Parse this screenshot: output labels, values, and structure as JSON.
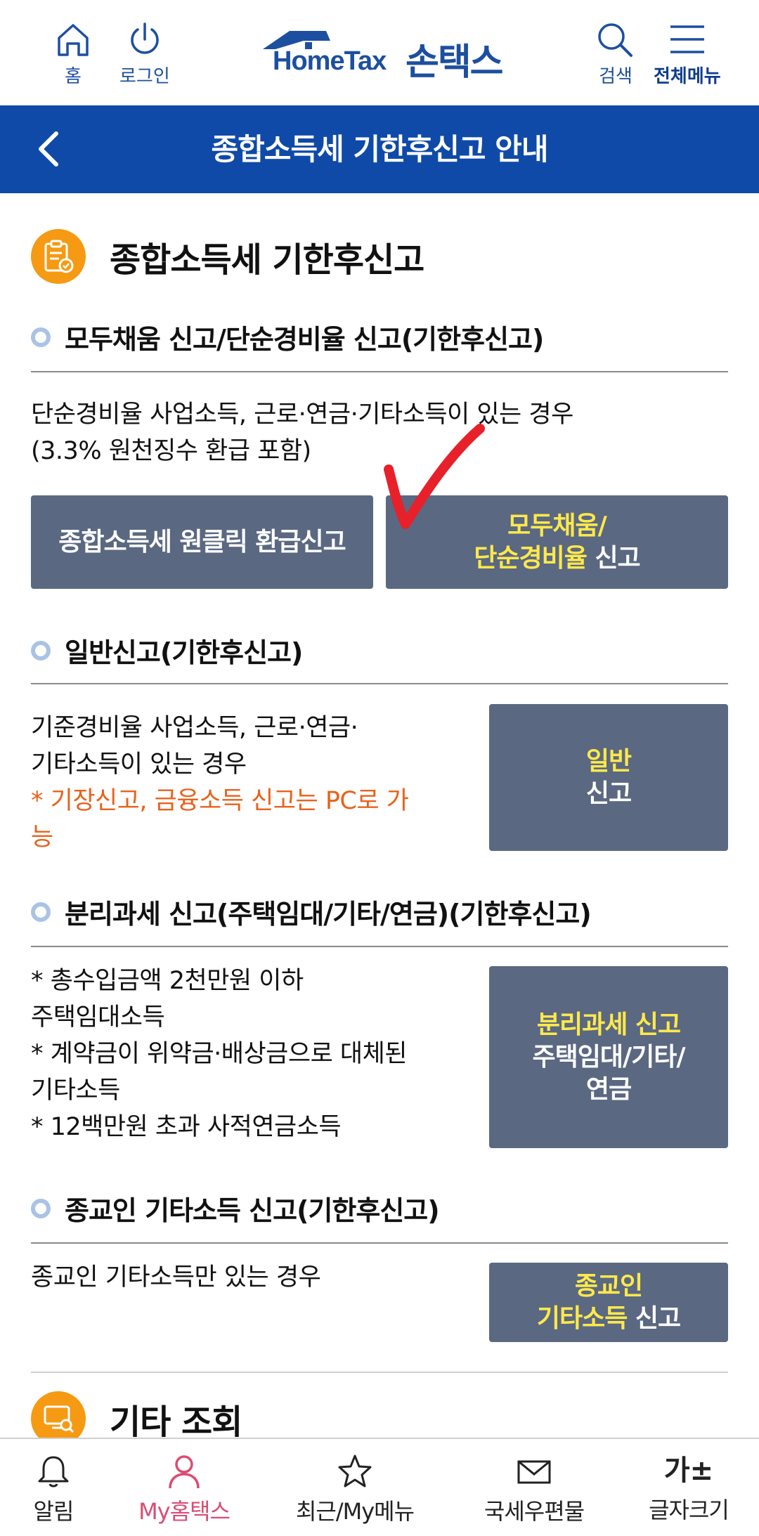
{
  "header": {
    "home_label": "홈",
    "login_label": "로그인",
    "logo_en": "HomeTax",
    "logo_ko": "손택스",
    "search_label": "검색",
    "menu_label": "전체메뉴"
  },
  "title_bar": {
    "title": "종합소득세 기한후신고 안내"
  },
  "section_filing": {
    "title": "종합소득세 기한후신고",
    "groups": [
      {
        "heading": "모두채움 신고/단순경비율 신고(기한후신고)",
        "desc_line1": "단순경비율 사업소득, 근로·연금·기타소득이 있는 경우",
        "desc_line2": "(3.3% 원천징수 환급 포함)",
        "button_oneclick": "종합소득세 원클릭 환급신고",
        "button_modu_line1": "모두채움/",
        "button_modu_line2_yellow": "단순경비율",
        "button_modu_line2_white": " 신고"
      },
      {
        "heading": "일반신고(기한후신고)",
        "desc_line1": "기준경비율 사업소득, 근로·연금·",
        "desc_line2": "기타소득이 있는 경우",
        "desc_note_line1": "* 기장신고, 금융소득 신고는 PC로 가",
        "desc_note_line2": "능",
        "button_line1": "일반",
        "button_line2": "신고"
      },
      {
        "heading": "분리과세 신고(주택임대/기타/연금)(기한후신고)",
        "desc_line1": "* 총수입금액 2천만원 이하",
        "desc_line2": "주택임대소득",
        "desc_line3": "* 계약금이 위약금·배상금으로 대체된",
        "desc_line4": "기타소득",
        "desc_line5": "* 12백만원 초과 사적연금소득",
        "button_line1": "분리과세 신고",
        "button_line2": "주택임대/기타/",
        "button_line3": "연금"
      },
      {
        "heading": "종교인 기타소득 신고(기한후신고)",
        "desc_line1": "종교인 기타소득만 있는 경우",
        "button_line1": "종교인",
        "button_line2_yellow": "기타소득",
        "button_line2_white": " 신고"
      }
    ]
  },
  "section_other": {
    "title": "기타 조회"
  },
  "bottom_nav": {
    "alarm": "알림",
    "my_hometax": "My홈택스",
    "recent_my_menu": "최근/My메뉴",
    "tax_mail": "국세우편물",
    "font_size": "글자크기",
    "font_size_glyph": "가±"
  },
  "colors": {
    "brand_blue": "#0f4aa8",
    "button_slate": "#5a6882",
    "button_highlight": "#ffe94a",
    "note_orange": "#e8621b",
    "section_icon_orange": "#f59a12",
    "active_nav_pink": "#d94d74",
    "annotation_red": "#e8202a"
  }
}
